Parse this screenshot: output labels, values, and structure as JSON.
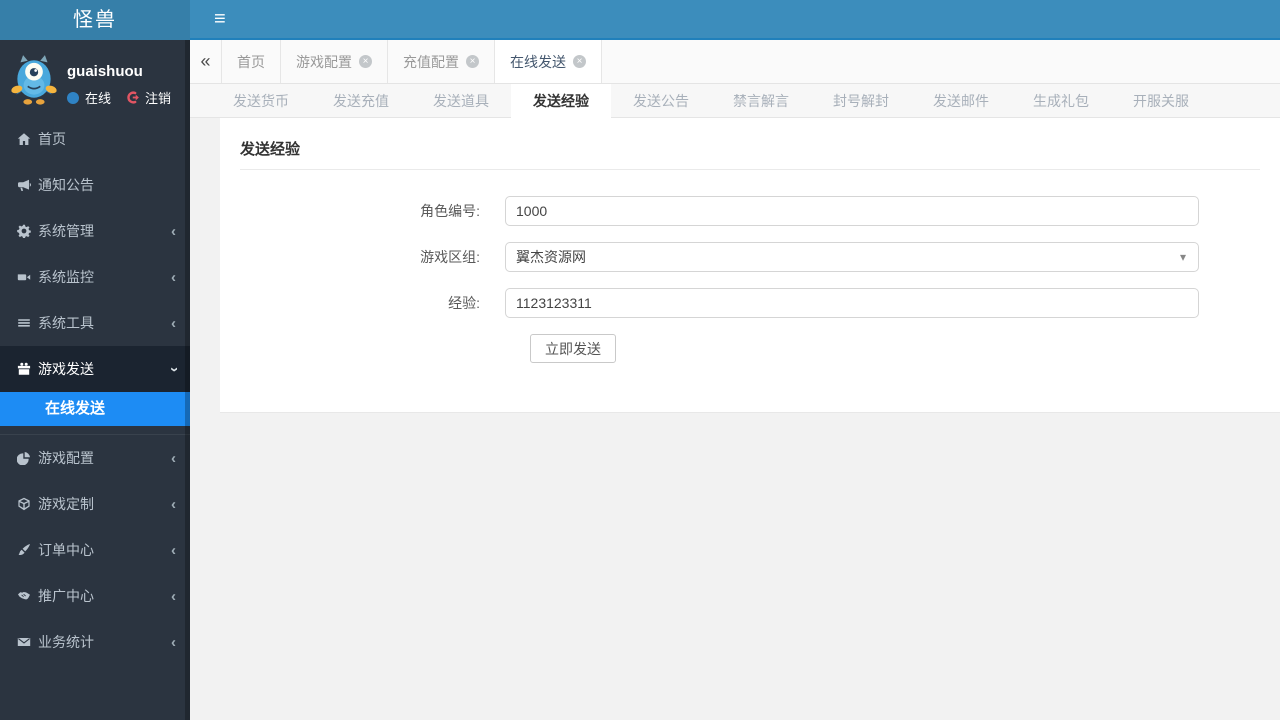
{
  "colors": {
    "navbar": "#3c8dbc",
    "logo_bg": "#367fa9",
    "navbar_underline": "#2080bb",
    "sidebar_bg": "#2b3440",
    "sidebar_parent_active_bg": "#1b2430",
    "submenu_active_bg": "#1d8cf4",
    "status_dot_blue": "#2f83c5",
    "logout_red": "#e25563",
    "content_bg": "#f2f2f2"
  },
  "navbar": {
    "logo": "怪兽",
    "hamburger": "≡"
  },
  "user": {
    "name": "guaishuou",
    "status": "在线",
    "logout": "注销"
  },
  "sidebar": {
    "items": [
      {
        "label": "首页",
        "icon": "home-icon"
      },
      {
        "label": "通知公告",
        "icon": "bullhorn-icon"
      },
      {
        "label": "系统管理",
        "icon": "gear-icon",
        "chevron": "‹"
      },
      {
        "label": "系统监控",
        "icon": "video-camera-icon",
        "chevron": "‹"
      },
      {
        "label": "系统工具",
        "icon": "list-icon",
        "chevron": "‹"
      },
      {
        "label": "游戏发送",
        "icon": "gift-icon",
        "chevron": "‹",
        "expanded": true,
        "children": [
          {
            "label": "在线发送",
            "active": true
          }
        ]
      },
      {
        "label": "游戏配置",
        "icon": "dashboard-icon",
        "chevron": "‹"
      },
      {
        "label": "游戏定制",
        "icon": "cube-icon",
        "chevron": "‹"
      },
      {
        "label": "订单中心",
        "icon": "brush-icon",
        "chevron": "‹"
      },
      {
        "label": "推广中心",
        "icon": "handshake-icon",
        "chevron": "‹"
      },
      {
        "label": "业务统计",
        "icon": "envelope-icon",
        "chevron": "‹"
      }
    ]
  },
  "tabstrip": {
    "collapse_icon": "«",
    "close_glyph": "×",
    "tabs": [
      {
        "label": "首页",
        "closable": false,
        "active": false
      },
      {
        "label": "游戏配置",
        "closable": true,
        "active": false
      },
      {
        "label": "充值配置",
        "closable": true,
        "active": false
      },
      {
        "label": "在线发送",
        "closable": true,
        "active": true
      }
    ]
  },
  "subtabs": {
    "active": "发送经验",
    "tabs": [
      "发送货币",
      "发送充值",
      "发送道具",
      "发送经验",
      "发送公告",
      "禁言解言",
      "封号解封",
      "发送邮件",
      "生成礼包",
      "开服关服"
    ]
  },
  "panel": {
    "title": "发送经验",
    "form": {
      "fields": [
        {
          "label": "角色编号:",
          "value": "1000",
          "type": "text"
        },
        {
          "label": "游戏区组:",
          "value": "翼杰资源网",
          "type": "select"
        },
        {
          "label": "经验:",
          "value": "1123123311",
          "type": "text"
        }
      ],
      "submit_label": "立即发送"
    }
  },
  "icons": {
    "caret_down": "▾"
  }
}
